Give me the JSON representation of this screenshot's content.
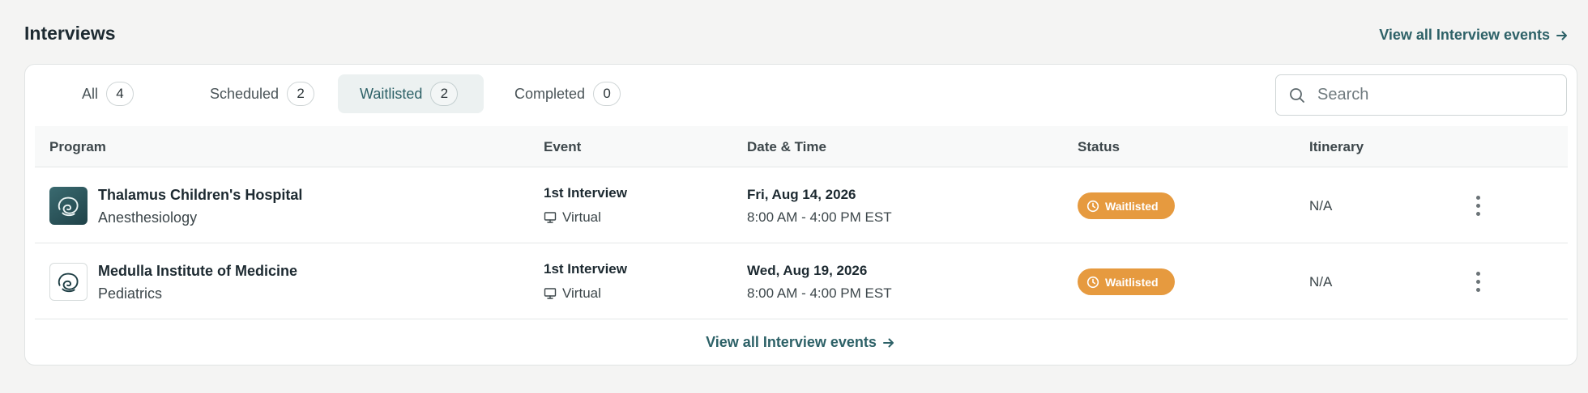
{
  "header": {
    "title": "Interviews",
    "view_all_label": "View all Interview events"
  },
  "tabs": [
    {
      "label": "All",
      "count": "4"
    },
    {
      "label": "Scheduled",
      "count": "2"
    },
    {
      "label": "Waitlisted",
      "count": "2",
      "active": true
    },
    {
      "label": "Completed",
      "count": "0"
    }
  ],
  "search": {
    "placeholder": "Search",
    "value": ""
  },
  "table": {
    "columns": [
      "Program",
      "Event",
      "Date & Time",
      "Status",
      "Itinerary"
    ],
    "rows": [
      {
        "program": "Thalamus Children's Hospital",
        "department": "Anesthesiology",
        "logo_icon": "brain-swirl-icon",
        "event": "1st Interview",
        "event_type": "Virtual",
        "date": "Fri, Aug 14, 2026",
        "time": "8:00 AM - 4:00 PM EST",
        "status": "Waitlisted",
        "itinerary": "N/A"
      },
      {
        "program": "Medulla Institute of Medicine",
        "department": "Pediatrics",
        "logo_icon": "brain-swirl-icon",
        "event": "1st Interview",
        "event_type": "Virtual",
        "date": "Wed, Aug 19, 2026",
        "time": "8:00 AM - 4:00 PM EST",
        "status": "Waitlisted",
        "itinerary": "N/A"
      }
    ]
  },
  "footer": {
    "view_all_label": "View all Interview events"
  },
  "colors": {
    "accent": "#2d6167",
    "status_waitlisted": "#e69a3f",
    "background": "#f4f4f3"
  }
}
